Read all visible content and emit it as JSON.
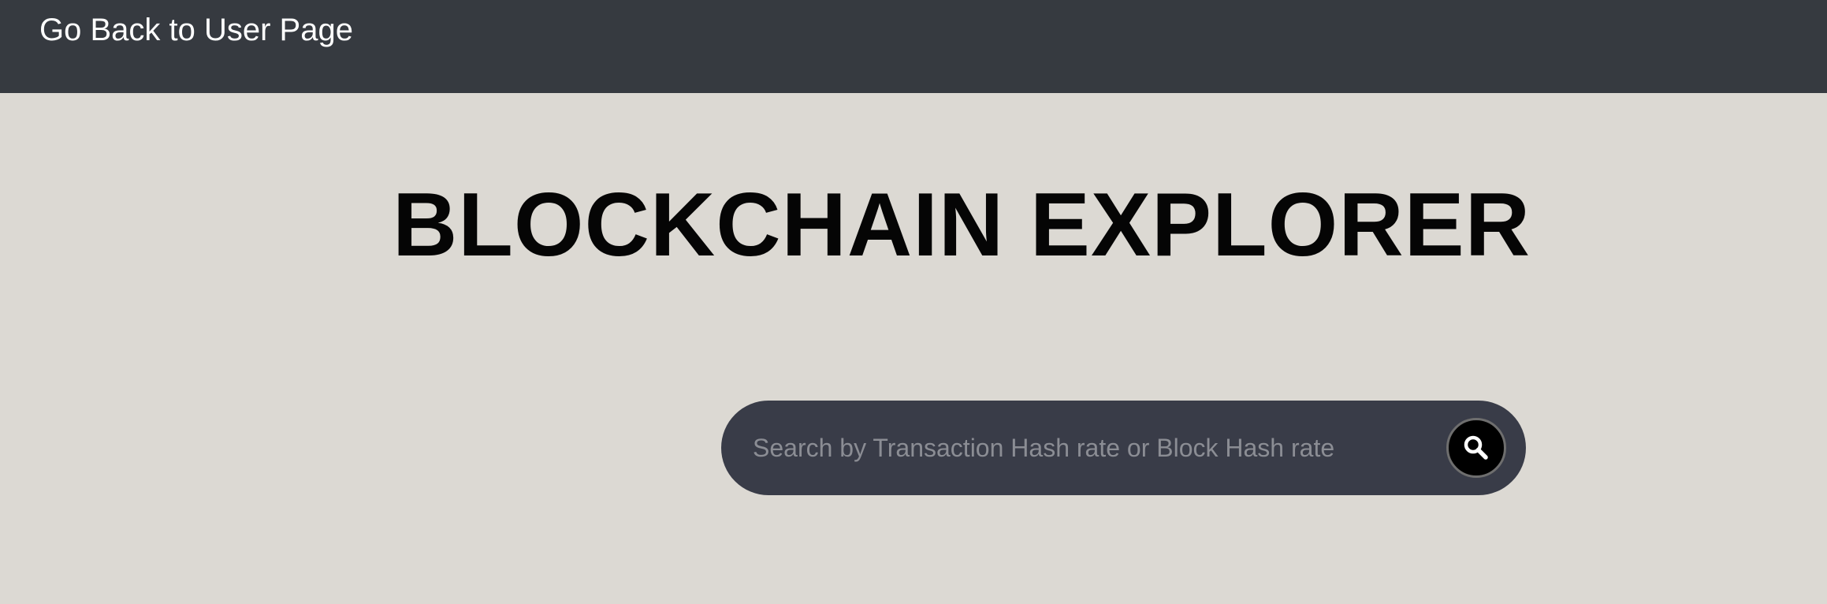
{
  "header": {
    "back_link_label": "Go Back to User Page"
  },
  "main": {
    "title": "BLOCKCHAIN EXPLORER",
    "search": {
      "placeholder": "Search by Transaction Hash rate or Block Hash rate",
      "value": "",
      "button_icon": "search-icon"
    }
  },
  "colors": {
    "page_background": "#dcd9d3",
    "header_background": "#363a40",
    "search_bar_background": "#393c48",
    "search_button_background": "#000000"
  }
}
